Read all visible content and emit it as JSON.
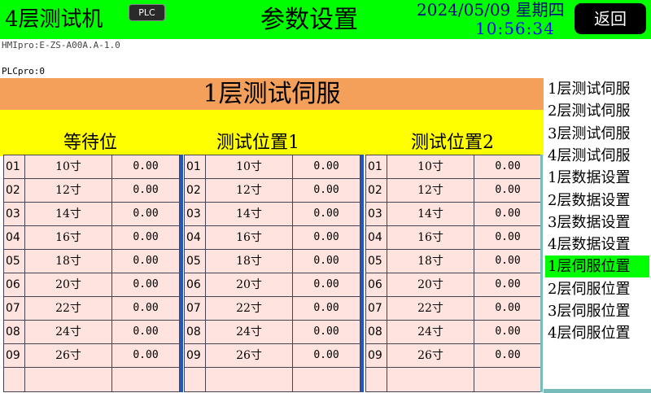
{
  "header": {
    "device_title": "4层测试机",
    "plc_badge": "PLC",
    "page_title": "参数设置",
    "date": "2024/05/09 星期四",
    "time": "10:56:34",
    "back_label": "返回"
  },
  "versions": {
    "hmi": "HMIpro:E-ZS-A00A.A-1.0",
    "plc": "PLCpro:0"
  },
  "panel": {
    "title": "1层测试伺服",
    "groups": [
      {
        "title": "等待位",
        "rows": [
          {
            "idx": "01",
            "size": "10寸",
            "value": "0.00"
          },
          {
            "idx": "02",
            "size": "12寸",
            "value": "0.00"
          },
          {
            "idx": "03",
            "size": "14寸",
            "value": "0.00"
          },
          {
            "idx": "04",
            "size": "16寸",
            "value": "0.00"
          },
          {
            "idx": "05",
            "size": "18寸",
            "value": "0.00"
          },
          {
            "idx": "06",
            "size": "20寸",
            "value": "0.00"
          },
          {
            "idx": "07",
            "size": "22寸",
            "value": "0.00"
          },
          {
            "idx": "08",
            "size": "24寸",
            "value": "0.00"
          },
          {
            "idx": "09",
            "size": "26寸",
            "value": "0.00"
          }
        ]
      },
      {
        "title": "测试位置1",
        "rows": [
          {
            "idx": "01",
            "size": "10寸",
            "value": "0.00"
          },
          {
            "idx": "02",
            "size": "12寸",
            "value": "0.00"
          },
          {
            "idx": "03",
            "size": "14寸",
            "value": "0.00"
          },
          {
            "idx": "04",
            "size": "16寸",
            "value": "0.00"
          },
          {
            "idx": "05",
            "size": "18寸",
            "value": "0.00"
          },
          {
            "idx": "06",
            "size": "20寸",
            "value": "0.00"
          },
          {
            "idx": "07",
            "size": "22寸",
            "value": "0.00"
          },
          {
            "idx": "08",
            "size": "24寸",
            "value": "0.00"
          },
          {
            "idx": "09",
            "size": "26寸",
            "value": "0.00"
          }
        ]
      },
      {
        "title": "测试位置2",
        "rows": [
          {
            "idx": "01",
            "size": "10寸",
            "value": "0.00"
          },
          {
            "idx": "02",
            "size": "12寸",
            "value": "0.00"
          },
          {
            "idx": "03",
            "size": "14寸",
            "value": "0.00"
          },
          {
            "idx": "04",
            "size": "16寸",
            "value": "0.00"
          },
          {
            "idx": "05",
            "size": "18寸",
            "value": "0.00"
          },
          {
            "idx": "06",
            "size": "20寸",
            "value": "0.00"
          },
          {
            "idx": "07",
            "size": "22寸",
            "value": "0.00"
          },
          {
            "idx": "08",
            "size": "24寸",
            "value": "0.00"
          },
          {
            "idx": "09",
            "size": "26寸",
            "value": "0.00"
          }
        ]
      }
    ]
  },
  "nav": {
    "items": [
      {
        "label": "1层测试伺服",
        "active": false
      },
      {
        "label": "2层测试伺服",
        "active": false
      },
      {
        "label": "3层测试伺服",
        "active": false
      },
      {
        "label": "4层测试伺服",
        "active": false
      },
      {
        "label": "1层数据设置",
        "active": false
      },
      {
        "label": "2层数据设置",
        "active": false
      },
      {
        "label": "3层数据设置",
        "active": false
      },
      {
        "label": "4层数据设置",
        "active": false
      },
      {
        "label": "1层伺服位置",
        "active": true
      },
      {
        "label": "2层伺服位置",
        "active": false
      },
      {
        "label": "3层伺服位置",
        "active": false
      },
      {
        "label": "4层伺服位置",
        "active": false
      }
    ]
  },
  "colors": {
    "header_bg": "#00ff00",
    "title_bar": "#f5a05a",
    "group_bar": "#ffff00",
    "table_bg": "#ffe3de",
    "separator": "#2056c8",
    "active_nav": "#00ff00"
  }
}
